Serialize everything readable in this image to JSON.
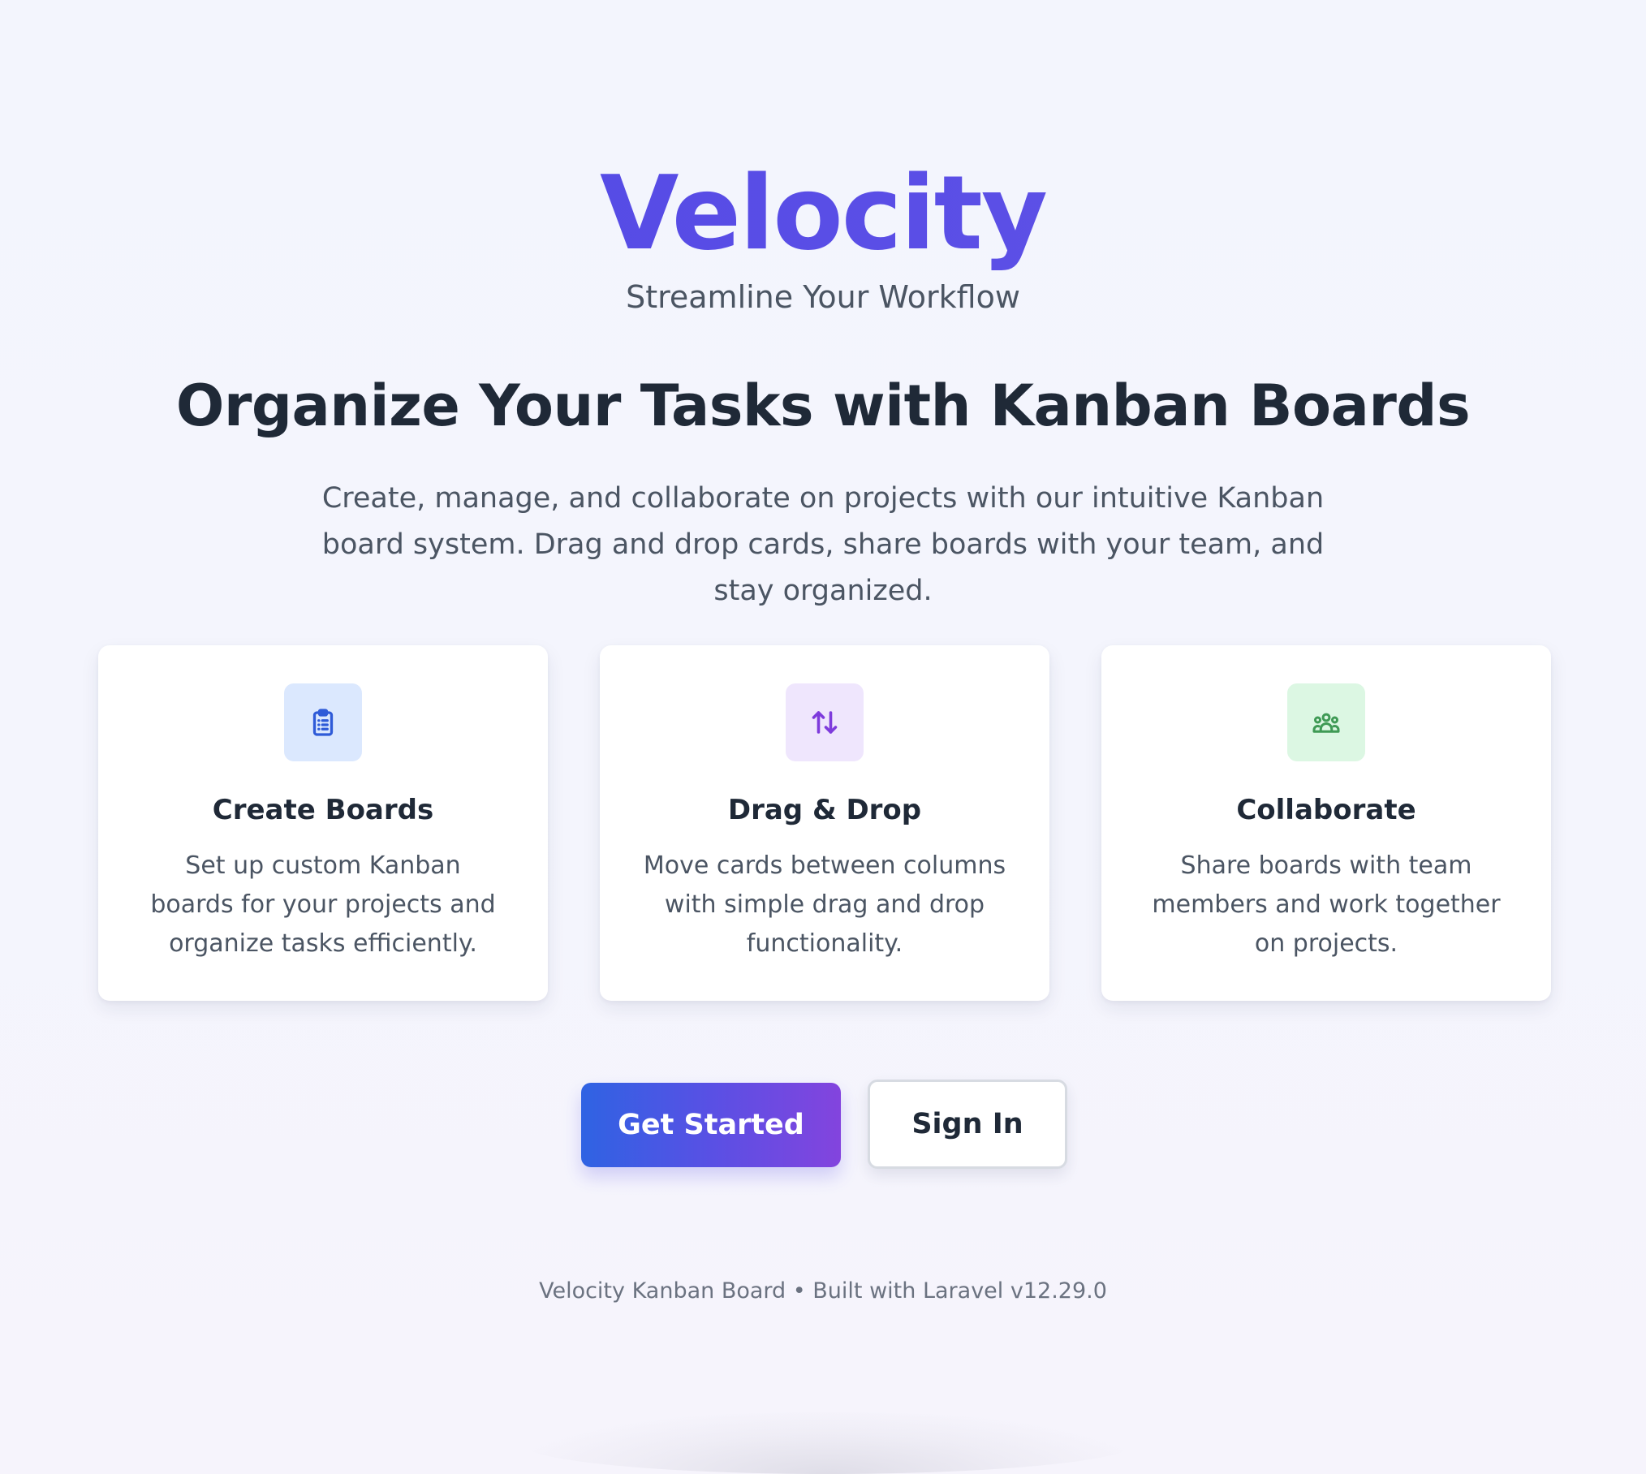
{
  "hero": {
    "brand": "Velocity",
    "tagline": "Streamline Your Workflow",
    "headline": "Organize Your Tasks with Kanban Boards",
    "intro": "Create, manage, and collaborate on projects with our intuitive Kanban board system. Drag and drop cards, share boards with your team, and stay organized."
  },
  "features": [
    {
      "icon": "clipboard-list-icon",
      "icon_color": "#2f5bd8",
      "icon_bg": "#dbe8fe",
      "title": "Create Boards",
      "text": "Set up custom Kanban boards for your projects and organize tasks efficiently."
    },
    {
      "icon": "arrows-up-down-icon",
      "icon_color": "#7e3bdc",
      "icon_bg": "#efe6fd",
      "title": "Drag & Drop",
      "text": "Move cards between columns with simple drag and drop functionality."
    },
    {
      "icon": "users-group-icon",
      "icon_color": "#3f9a55",
      "icon_bg": "#dcf7e3",
      "title": "Collaborate",
      "text": "Share boards with team members and work together on projects."
    }
  ],
  "actions": {
    "primary_label": "Get Started",
    "secondary_label": "Sign In"
  },
  "footer": {
    "text": "Velocity Kanban Board • Built with Laravel v12.29.0"
  },
  "colors": {
    "brand": "#5a53e3",
    "button_gradient_start": "#2f63e3",
    "button_gradient_end": "#8344de",
    "background": "#f3f5fd"
  }
}
